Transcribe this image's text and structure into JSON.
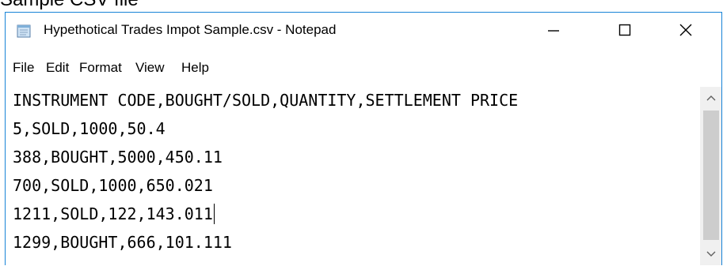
{
  "caption": "Sample CSV file",
  "window": {
    "title": "Hypethotical Trades Impot Sample.csv - Notepad",
    "icon": "notepad-icon"
  },
  "menu": [
    "File",
    "Edit",
    "Format",
    "View",
    "Help"
  ],
  "editor": {
    "lines": [
      "INSTRUMENT CODE,BOUGHT/SOLD,QUANTITY,SETTLEMENT PRICE",
      "5,SOLD,1000,50.4",
      "388,BOUGHT,5000,450.11",
      "700,SOLD,1000,650.021",
      "1211,SOLD,122,143.011",
      "1299,BOUGHT,666,101.111"
    ]
  }
}
